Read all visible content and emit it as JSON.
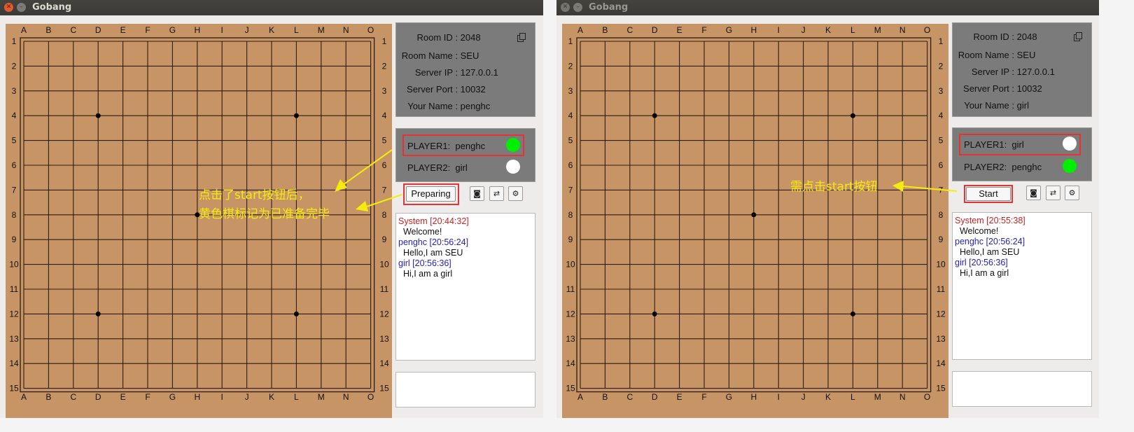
{
  "windows": [
    {
      "title": "Gobang",
      "room": {
        "id_label": "Room ID :",
        "id_value": "2048",
        "name_label": "Room Name :",
        "name_value": "SEU",
        "ip_label": "Server IP :",
        "ip_value": "127.0.0.1",
        "port_label": "Server Port :",
        "port_value": "10032",
        "your_label": "Your Name :",
        "your_value": "penghc"
      },
      "players": [
        {
          "label": "PLAYER1:",
          "name": "penghc",
          "status_color": "#00ee00"
        },
        {
          "label": "PLAYER2:",
          "name": "girl",
          "status_color": "#ffffff"
        }
      ],
      "action_button": "Preparing",
      "chat": [
        {
          "text": "System [20:44:32]",
          "color": "#cc2222"
        },
        {
          "text": "  Welcome!",
          "color": "#111111"
        },
        {
          "text": "penghc [20:56:24]",
          "color": "#2222bb"
        },
        {
          "text": "  Hello,I am SEU",
          "color": "#111111"
        },
        {
          "text": "girl [20:56:36]",
          "color": "#2222bb"
        },
        {
          "text": "  Hi,I am a girl",
          "color": "#111111"
        }
      ],
      "annotation_lines": [
        "点击了start按钮后，",
        "黄色棋标记为已准备完毕"
      ],
      "stones": [
        {
          "col": "H",
          "row": 8
        }
      ]
    },
    {
      "title": "Gobang",
      "room": {
        "id_label": "Room ID :",
        "id_value": "2048",
        "name_label": "Room Name :",
        "name_value": "SEU",
        "ip_label": "Server IP :",
        "ip_value": "127.0.0.1",
        "port_label": "Server Port :",
        "port_value": "10032",
        "your_label": "Your Name :",
        "your_value": "girl"
      },
      "players": [
        {
          "label": "PLAYER1:",
          "name": "girl",
          "status_color": "#ffffff"
        },
        {
          "label": "PLAYER2:",
          "name": "penghc",
          "status_color": "#00ee00"
        }
      ],
      "action_button": "Start",
      "chat": [
        {
          "text": "System [20:55:38]",
          "color": "#cc2222"
        },
        {
          "text": "  Welcome!",
          "color": "#111111"
        },
        {
          "text": "penghc [20:56:24]",
          "color": "#2222bb"
        },
        {
          "text": "  Hello,I am SEU",
          "color": "#111111"
        },
        {
          "text": "girl [20:56:36]",
          "color": "#2222bb"
        },
        {
          "text": "  Hi,I am a girl",
          "color": "#111111"
        }
      ],
      "annotation_lines": [
        "需点击start按钮"
      ],
      "stones": [
        {
          "col": "H",
          "row": 8
        }
      ]
    }
  ],
  "board": {
    "columns": [
      "A",
      "B",
      "C",
      "D",
      "E",
      "F",
      "G",
      "H",
      "I",
      "J",
      "K",
      "L",
      "M",
      "N",
      "O"
    ],
    "rows": [
      "1",
      "2",
      "3",
      "4",
      "5",
      "6",
      "7",
      "8",
      "9",
      "10",
      "11",
      "12",
      "13",
      "14",
      "15"
    ],
    "star_points": [
      {
        "col": "D",
        "row": 4
      },
      {
        "col": "L",
        "row": 4
      },
      {
        "col": "D",
        "row": 12
      },
      {
        "col": "L",
        "row": 12
      }
    ]
  },
  "icons": [
    "screenshot-icon",
    "swap-icon",
    "gear-icon",
    "copy-icon"
  ],
  "colors": {
    "board": "#c79466",
    "panel": "#7b7b7b",
    "highlight": "#e53333",
    "annotation": "#f5ec0d"
  }
}
